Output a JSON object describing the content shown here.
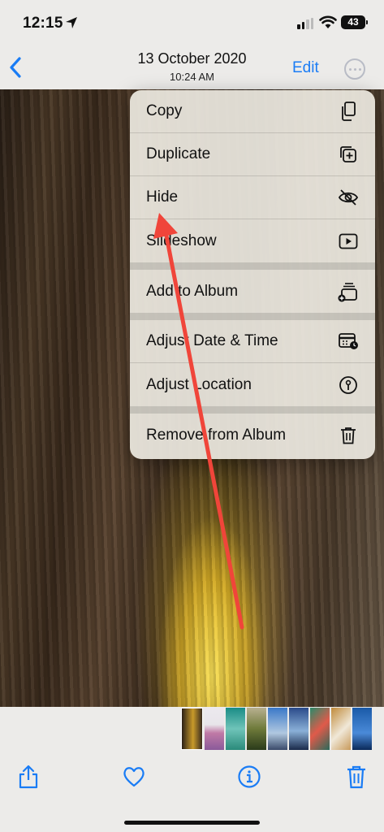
{
  "status_bar": {
    "time": "12:15",
    "battery": "43"
  },
  "header": {
    "date": "13 October 2020",
    "time": "10:24 AM",
    "edit_label": "Edit",
    "back_icon": "chevron-left-icon",
    "more_icon": "ellipsis-circle-icon",
    "accent_color": "#1a7cf5"
  },
  "menu": {
    "groups": [
      [
        {
          "label": "Copy",
          "icon": "copy-icon"
        },
        {
          "label": "Duplicate",
          "icon": "duplicate-icon"
        },
        {
          "label": "Hide",
          "icon": "eye-slash-icon"
        },
        {
          "label": "Slideshow",
          "icon": "play-icon"
        }
      ],
      [
        {
          "label": "Add to Album",
          "icon": "add-to-album-icon"
        }
      ],
      [
        {
          "label": "Adjust Date & Time",
          "icon": "calendar-clock-icon"
        },
        {
          "label": "Adjust Location",
          "icon": "location-icon"
        }
      ],
      [
        {
          "label": "Remove from Album",
          "icon": "trash-icon"
        }
      ]
    ]
  },
  "annotation": {
    "color": "#f0453a",
    "points_to": "Hide"
  },
  "toolbar": {
    "share_icon": "share-icon",
    "favorite_icon": "heart-icon",
    "info_icon": "info-icon",
    "delete_icon": "trash-icon"
  }
}
